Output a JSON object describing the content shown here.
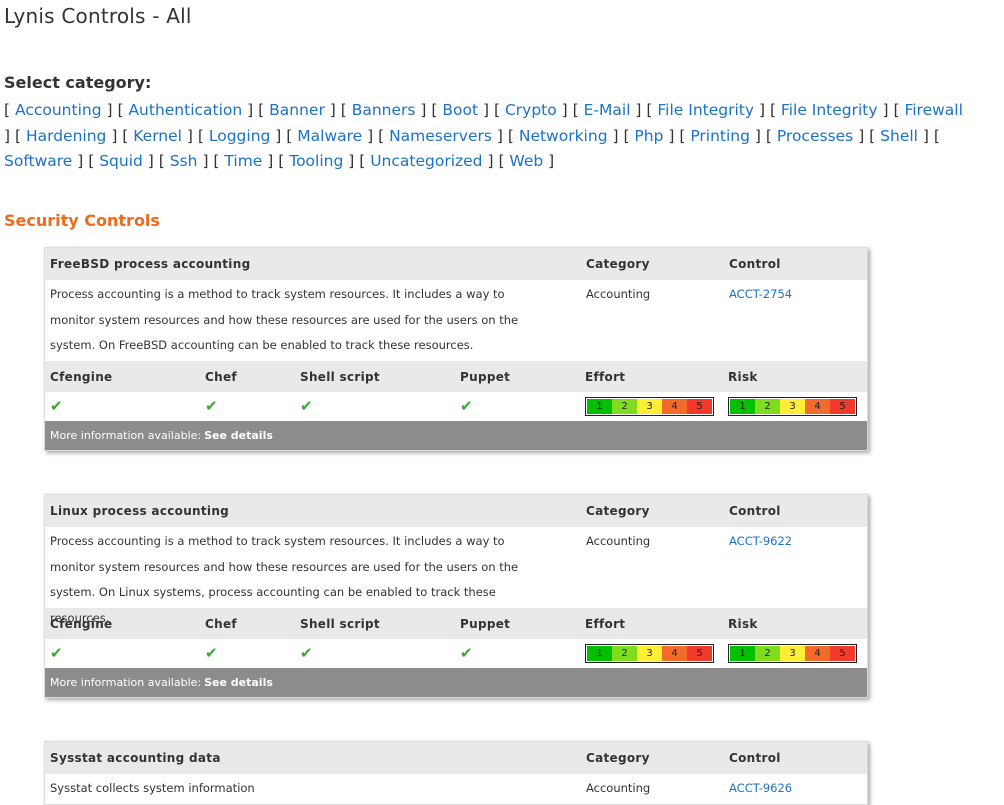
{
  "page_title": "Lynis Controls - All",
  "select_category_label": "Select category:",
  "categories": [
    "Accounting",
    "Authentication",
    "Banner",
    "Banners",
    "Boot",
    "Crypto",
    "E-Mail",
    "File Integrity",
    "File Integrity",
    "Firewall",
    "Hardening",
    "Kernel",
    "Logging",
    "Malware",
    "Nameservers",
    "Networking",
    "Php",
    "Printing",
    "Processes",
    "Shell",
    "Software",
    "Squid",
    "Ssh",
    "Time",
    "Tooling",
    "Uncategorized",
    "Web"
  ],
  "section_title": "Security Controls",
  "colors": {
    "link": "#1a73c8",
    "section": "#ee6a1d",
    "check": "#3aaa2e",
    "footer": "#8c8c8c"
  },
  "headers": {
    "category": "Category",
    "control": "Control",
    "cfengine": "Cfengine",
    "chef": "Chef",
    "shell": "Shell script",
    "puppet": "Puppet",
    "effort": "Effort",
    "risk": "Risk"
  },
  "scale": [
    "1",
    "2",
    "3",
    "4",
    "5"
  ],
  "more_info": "More information available:",
  "see_details": "See details",
  "check_icon": "checkmark-icon",
  "controls": [
    {
      "title": "FreeBSD process accounting",
      "description": "Process accounting is a method to track system resources. It includes a way to monitor system resources and how these resources are used for the users on the system. On FreeBSD accounting can be enabled to track these resources.",
      "category": "Accounting",
      "control": "ACCT-2754"
    },
    {
      "title": "Linux process accounting",
      "description": "Process accounting is a method to track system resources. It includes a way to monitor system resources and how these resources are used for the users on the system. On Linux systems, process accounting can be enabled to track these resources.",
      "category": "Accounting",
      "control": "ACCT-9622"
    },
    {
      "title": "Sysstat accounting data",
      "description": "Sysstat collects system information",
      "category": "Accounting",
      "control": "ACCT-9626"
    }
  ]
}
